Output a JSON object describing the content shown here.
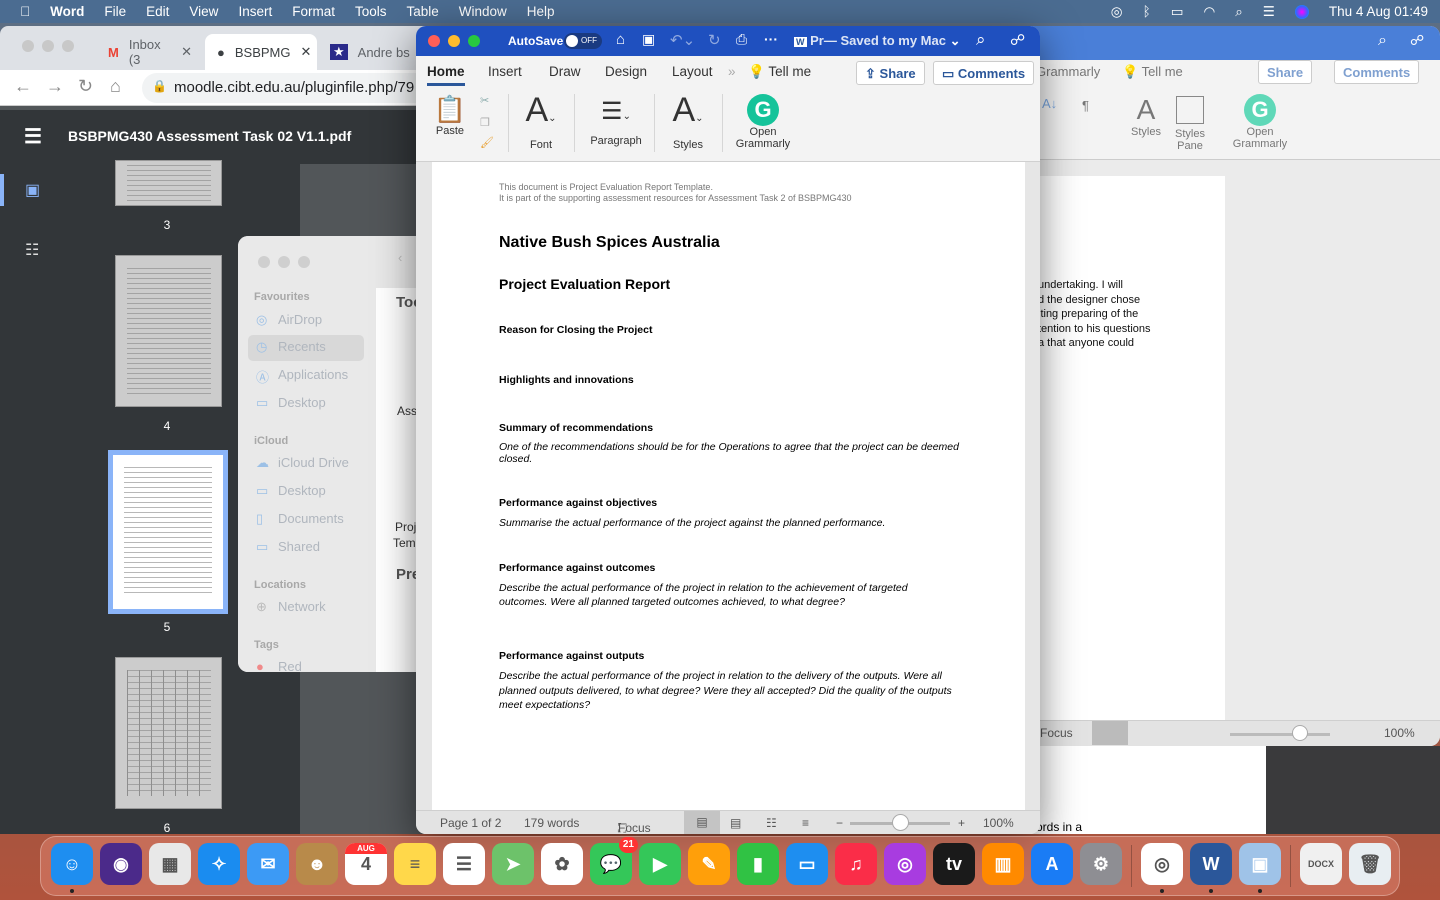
{
  "menubar": {
    "app": "Word",
    "items": [
      "File",
      "Edit",
      "View",
      "Insert",
      "Format",
      "Tools",
      "Table",
      "Window",
      "Help"
    ],
    "datetime": "Thu 4 Aug  01:49",
    "status_icons": [
      "airdrop-icon",
      "bluetooth-icon",
      "battery-icon",
      "wifi-icon",
      "spotlight-icon",
      "control-center-icon",
      "siri-icon"
    ]
  },
  "chrome": {
    "tabs": [
      {
        "label": "Inbox (3",
        "icon": "gmail-icon"
      },
      {
        "label": "BSBPMG",
        "icon": "globe-icon"
      },
      {
        "label": "Andre bs",
        "icon": "star-shield-icon"
      }
    ],
    "url": "moodle.cibt.edu.au/pluginfile.php/79",
    "pdf_title": "BSBPMG430 Assessment Task 02 V1.1.pdf",
    "thumb_pages": [
      "3",
      "4",
      "5",
      "6"
    ],
    "selected_page": "5"
  },
  "finder": {
    "sections": [
      {
        "title": "Favourites",
        "items": [
          "AirDrop",
          "Recents",
          "Applications",
          "Desktop"
        ]
      },
      {
        "title": "iCloud",
        "items": [
          "iCloud Drive",
          "Desktop",
          "Documents",
          "Shared"
        ]
      },
      {
        "title": "Locations",
        "items": [
          "Network"
        ]
      },
      {
        "title": "Tags",
        "items": [
          "Red"
        ]
      }
    ],
    "selected": "Recents",
    "main_fragments": [
      "Toc",
      "Ass",
      "Proj",
      "Tem",
      "Pre"
    ]
  },
  "word": {
    "autosave": "AutoSave",
    "autosave_state": "OFF",
    "doc_title": "Pr— Saved to my Mac",
    "tabs": [
      "Home",
      "Insert",
      "Draw",
      "Design",
      "Layout"
    ],
    "active_tab": "Home",
    "more": "»",
    "tell_me": "Tell me",
    "share": "Share",
    "comments": "Comments",
    "ribbon": {
      "paste": "Paste",
      "font": "Font",
      "paragraph": "Paragraph",
      "styles": "Styles",
      "grammarly": "Open Grammarly"
    },
    "document": {
      "header_note": [
        "This document is Project Evaluation Report Template.",
        "It is part of the supporting assessment resources for Assessment Task 2 of BSBPMG430"
      ],
      "title": "Native Bush Spices Australia",
      "subtitle": "Project Evaluation Report",
      "sections": [
        {
          "heading": "Reason for Closing the Project",
          "body": ""
        },
        {
          "heading": "Highlights and innovations",
          "body": ""
        },
        {
          "heading": "Summary of recommendations",
          "body": "One of the recommendations should be for the Operations to agree that the project can be deemed closed."
        },
        {
          "heading": "Performance against objectives",
          "body": "Summarise the actual performance of the project against the planned performance."
        },
        {
          "heading": "Performance against outcomes",
          "body": "Describe the actual performance of the project in relation to the achievement of targeted outcomes. Were all planned targeted outcomes achieved, to what degree?"
        },
        {
          "heading": "Performance against outputs",
          "body": "Describe the actual performance of the project in relation to the delivery of the outputs. Were all planned outputs delivered, to what degree? Were they all accepted? Did the quality of the outputs meet expectations?"
        }
      ]
    },
    "status": {
      "page": "Page 1 of 2",
      "words": "179 words",
      "focus": "Focus",
      "zoom": "100%",
      "zoom_minus": "−",
      "zoom_plus": "+"
    }
  },
  "word2": {
    "tab_fragment": "Grammarly",
    "tell_me": "Tell me",
    "share": "Share",
    "comments": "Comments",
    "styles": "Styles",
    "styles_pane": "Styles Pane",
    "grammarly": "Open Grammarly",
    "text_lines": [
      "undertaking. I will",
      "d the designer chose",
      "lting preparing of the",
      "tention to his questions",
      "a that anyone could"
    ],
    "lower_fragment": "ords in a",
    "focus": "Focus",
    "zoom": "100%"
  },
  "dock": {
    "apps": [
      {
        "name": "Finder",
        "color": "#1e8ef0",
        "glyph": "☺",
        "running": true
      },
      {
        "name": "Siri",
        "color": "#4b2a8a",
        "glyph": "◉"
      },
      {
        "name": "Launchpad",
        "color": "#e8e8e8",
        "glyph": "▦"
      },
      {
        "name": "Safari",
        "color": "#1a8cf0",
        "glyph": "✧"
      },
      {
        "name": "Mail",
        "color": "#3c9af5",
        "glyph": "✉"
      },
      {
        "name": "Contacts",
        "color": "#b88a4a",
        "glyph": "☻"
      },
      {
        "name": "Calendar",
        "color": "#ffffff",
        "glyph": "4",
        "month": "AUG"
      },
      {
        "name": "Notes",
        "color": "#ffd84a",
        "glyph": "≡"
      },
      {
        "name": "Reminders",
        "color": "#ffffff",
        "glyph": "☰"
      },
      {
        "name": "Maps",
        "color": "#6dc26a",
        "glyph": "➤"
      },
      {
        "name": "Photos",
        "color": "#ffffff",
        "glyph": "✿"
      },
      {
        "name": "Messages",
        "color": "#34c759",
        "glyph": "💬",
        "badge": "21"
      },
      {
        "name": "FaceTime",
        "color": "#34c759",
        "glyph": "▶"
      },
      {
        "name": "Pages",
        "color": "#ff9f0a",
        "glyph": "✎"
      },
      {
        "name": "Numbers",
        "color": "#30c244",
        "glyph": "▮"
      },
      {
        "name": "Keynote",
        "color": "#1e8ef0",
        "glyph": "▭"
      },
      {
        "name": "Music",
        "color": "#fa2d48",
        "glyph": "♫"
      },
      {
        "name": "Podcasts",
        "color": "#a83ce0",
        "glyph": "◎"
      },
      {
        "name": "TV",
        "color": "#1a1a1a",
        "glyph": "tv"
      },
      {
        "name": "Books",
        "color": "#ff8a00",
        "glyph": "▥"
      },
      {
        "name": "App Store",
        "color": "#1a7cf5",
        "glyph": "A"
      },
      {
        "name": "System Preferences",
        "color": "#8e8e93",
        "glyph": "⚙"
      },
      {
        "name": "Chrome",
        "color": "#ffffff",
        "glyph": "◎",
        "running": true
      },
      {
        "name": "Word",
        "color": "#2b579a",
        "glyph": "W",
        "running": true
      },
      {
        "name": "Preview",
        "color": "#9fc3e8",
        "glyph": "▣",
        "running": true
      },
      {
        "name": "Document",
        "color": "#f0f0f0",
        "glyph": "DOCX"
      },
      {
        "name": "Trash",
        "color": "#e8eef2",
        "glyph": "🗑"
      }
    ]
  },
  "colors": {
    "word_blue": "#1f50bf",
    "grammarly": "#15c39a",
    "menubar": "#4b6c91",
    "pdf_dark": "#323639"
  }
}
